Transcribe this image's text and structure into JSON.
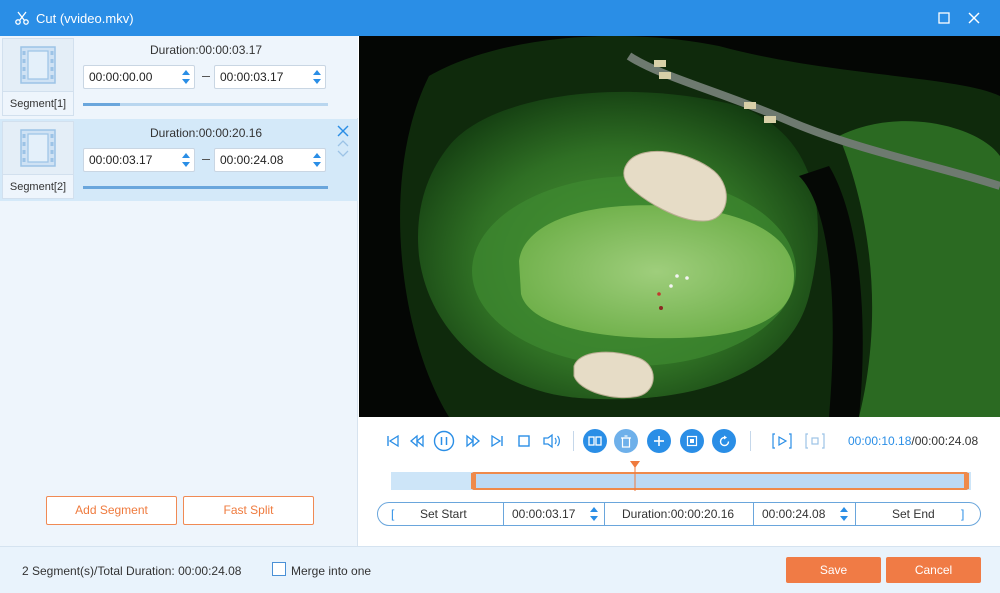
{
  "window": {
    "title": "Cut (vvideo.mkv)",
    "icons": [
      "scissors-icon",
      "maximize-icon",
      "close-icon"
    ]
  },
  "segments": [
    {
      "label": "Segment[1]",
      "duration": "Duration:00:00:03.17",
      "start": "00:00:00.00",
      "end": "00:00:03.17",
      "progress": 0.15
    },
    {
      "label": "Segment[2]",
      "duration": "Duration:00:00:20.16",
      "start": "00:00:03.17",
      "end": "00:00:24.08",
      "progress": 1.0
    }
  ],
  "left_buttons": {
    "add_segment": "Add Segment",
    "fast_split": "Fast Split"
  },
  "player": {
    "current_time": "00:00:10.18",
    "total_time": "/00:00:24.08",
    "playhead_fraction": 0.42,
    "selection_start_fraction": 0.14,
    "selection_end_fraction": 1.0
  },
  "cut_bar": {
    "set_start": "Set Start",
    "start_value": "00:00:03.17",
    "duration": "Duration:00:00:20.16",
    "end_value": "00:00:24.08",
    "set_end": "Set End",
    "left_bracket": "[",
    "right_bracket": "]"
  },
  "footer": {
    "summary": "2 Segment(s)/Total Duration: 00:00:24.08",
    "merge_label": "Merge into one",
    "save": "Save",
    "cancel": "Cancel"
  },
  "colors": {
    "accent": "#2a8ee6",
    "orange": "#f07b45",
    "selected_segment": "#d4e9f9"
  }
}
